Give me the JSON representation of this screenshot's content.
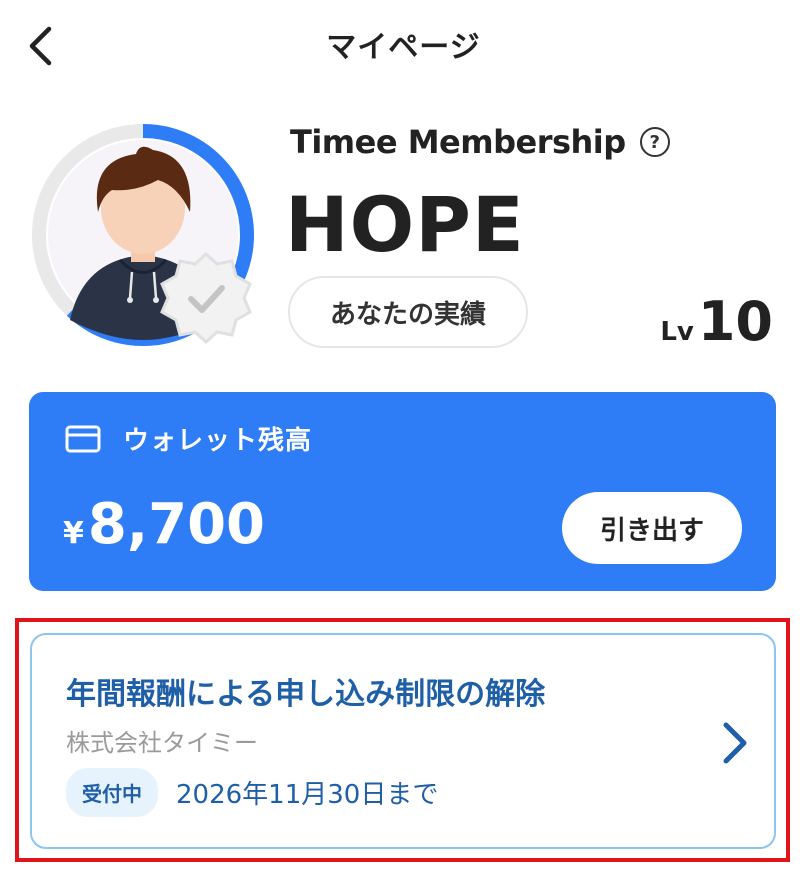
{
  "header": {
    "back_icon": "chevron-left-icon",
    "title": "マイページ"
  },
  "profile": {
    "avatar_icon": "user-avatar",
    "verified_icon": "verified-badge-icon",
    "progress_ring_fraction": 0.62,
    "membership_title": "Timee Membership",
    "help_icon": "question-circle-icon",
    "help_glyph": "?",
    "rank": "HOPE",
    "achievements_label": "あなたの実績",
    "level_prefix": "Lv",
    "level_value": "10"
  },
  "wallet": {
    "icon": "credit-card-icon",
    "label": "ウォレット残高",
    "currency_symbol": "¥",
    "amount": "8,700",
    "withdraw_label": "引き出す",
    "background_color": "#2e7cf6"
  },
  "notice": {
    "title": "年間報酬による申し込み制限の解除",
    "company": "株式会社タイミー",
    "status_badge": "受付中",
    "deadline": "2026年11月30日まで",
    "chevron_icon": "chevron-right-icon",
    "highlight_color": "#e1141a"
  }
}
